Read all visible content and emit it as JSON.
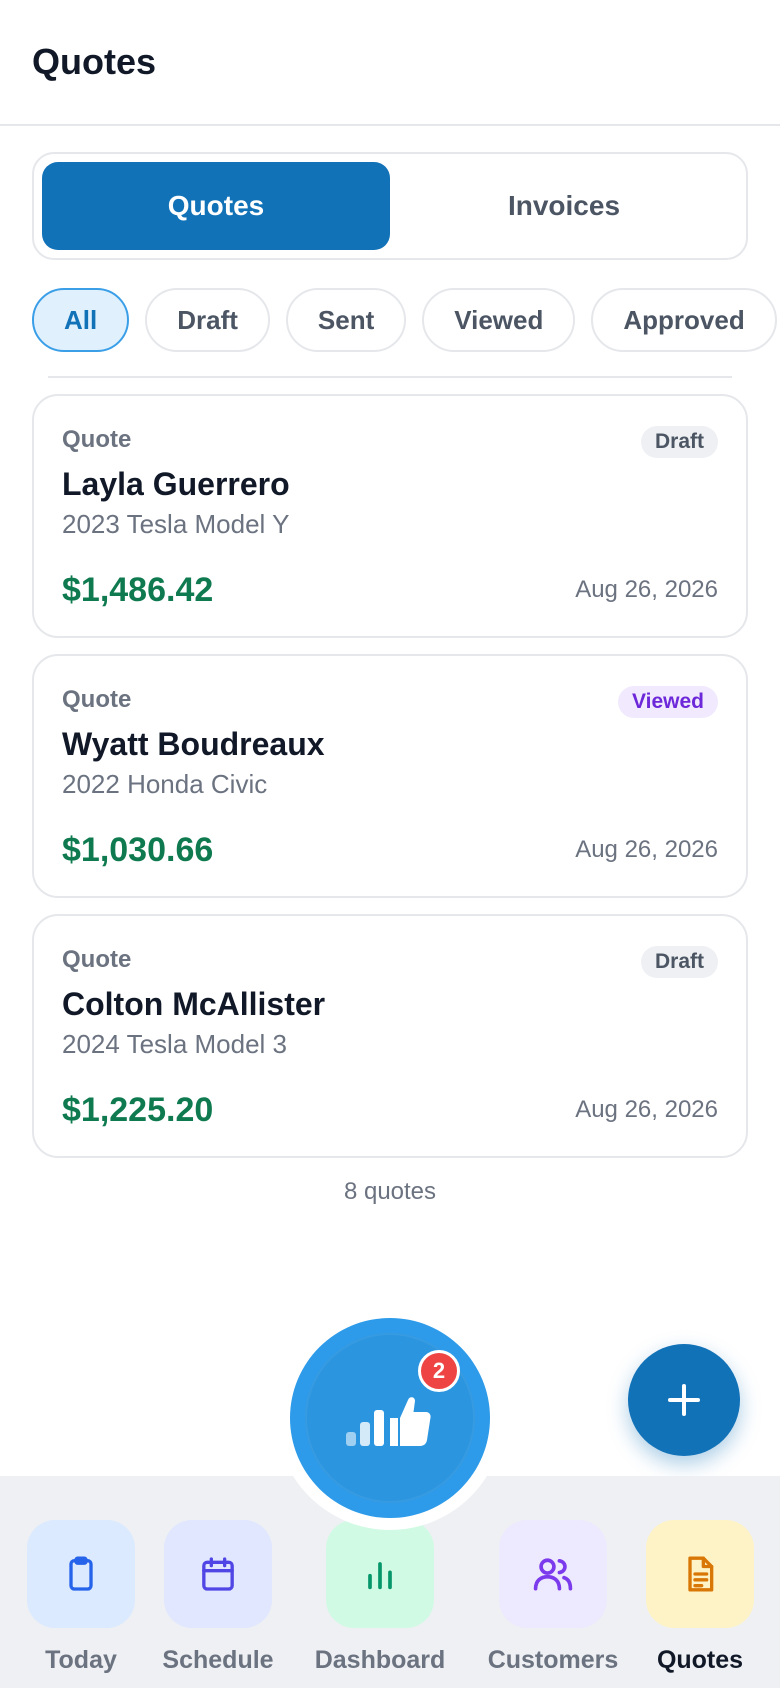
{
  "header": {
    "title": "Quotes"
  },
  "segments": {
    "quotes": "Quotes",
    "invoices": "Invoices"
  },
  "filters": [
    "All",
    "Draft",
    "Sent",
    "Viewed",
    "Approved"
  ],
  "quotes": [
    {
      "type": "Quote",
      "status": "Draft",
      "name": "Layla Guerrero",
      "vehicle": "2023 Tesla Model Y",
      "amount": "$1,486.42",
      "date": "Aug 26, 2026"
    },
    {
      "type": "Quote",
      "status": "Viewed",
      "name": "Wyatt Boudreaux",
      "vehicle": "2022 Honda Civic",
      "amount": "$1,030.66",
      "date": "Aug 26, 2026"
    },
    {
      "type": "Quote",
      "status": "Draft",
      "name": "Colton McAllister",
      "vehicle": "2024 Tesla Model 3",
      "amount": "$1,225.20",
      "date": "Aug 26, 2026"
    }
  ],
  "footer": {
    "count": "8 quotes"
  },
  "center_badge": {
    "count": "2",
    "icon": "thumbs-up-chart-icon"
  },
  "fab": {
    "icon": "plus-icon"
  },
  "tabs": [
    {
      "label": "Today",
      "icon": "clipboard-icon",
      "bg": "#dbeafe",
      "color": "#2563eb"
    },
    {
      "label": "Schedule",
      "icon": "calendar-icon",
      "bg": "#e0e7ff",
      "color": "#4f46e5"
    },
    {
      "label": "Dashboard",
      "icon": "bar-chart-icon",
      "bg": "#d1fae5",
      "color": "#059669"
    },
    {
      "label": "Customers",
      "icon": "users-icon",
      "bg": "#ede9fe",
      "color": "#7c3aed"
    },
    {
      "label": "Quotes",
      "icon": "document-icon",
      "bg": "#fef3c7",
      "color": "#d97706"
    }
  ],
  "colors": {
    "accent": "#1272b8",
    "amount": "#0f7a4f",
    "center": "#2d9be9"
  }
}
